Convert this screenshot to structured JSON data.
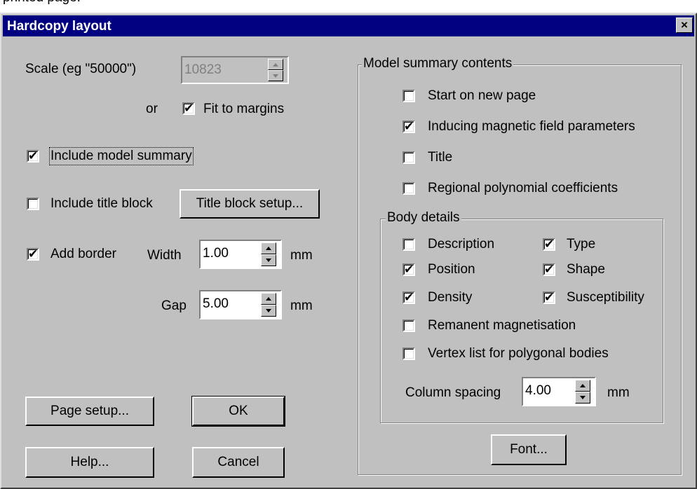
{
  "above_text": "printed page.",
  "window": {
    "title": "Hardcopy layout",
    "close": "×"
  },
  "scale": {
    "label": "Scale (eg \"50000\")",
    "value": "10823",
    "or_label": "or",
    "fit_to_margins": {
      "label": "Fit to margins",
      "checked": true
    }
  },
  "include_model_summary": {
    "label": "Include model summary",
    "checked": true
  },
  "include_title_block": {
    "label": "Include title block",
    "checked": false
  },
  "title_block_setup_button": "Title block setup...",
  "border": {
    "add_border": {
      "label": "Add border",
      "checked": true
    },
    "width_label": "Width",
    "width_value": "1.00",
    "width_unit": "mm",
    "gap_label": "Gap",
    "gap_value": "5.00",
    "gap_unit": "mm"
  },
  "buttons": {
    "page_setup": "Page setup...",
    "ok": "OK",
    "help": "Help...",
    "cancel": "Cancel",
    "font": "Font..."
  },
  "model_summary": {
    "group_label": "Model summary contents",
    "items": [
      {
        "label": "Start on new page",
        "checked": false
      },
      {
        "label": "Inducing magnetic field parameters",
        "checked": true
      },
      {
        "label": "Title",
        "checked": false
      },
      {
        "label": "Regional polynomial coefficients",
        "checked": false
      }
    ]
  },
  "body_details": {
    "group_label": "Body details",
    "description": {
      "label": "Description",
      "checked": false
    },
    "type": {
      "label": "Type",
      "checked": true
    },
    "position": {
      "label": "Position",
      "checked": true
    },
    "shape": {
      "label": "Shape",
      "checked": true
    },
    "density": {
      "label": "Density",
      "checked": true
    },
    "susceptibility": {
      "label": "Susceptibility",
      "checked": true
    },
    "remanent": {
      "label": "Remanent magnetisation",
      "checked": false
    },
    "vertex_list": {
      "label": "Vertex list for polygonal bodies",
      "checked": false
    },
    "column_spacing_label": "Column spacing",
    "column_spacing_value": "4.00",
    "column_spacing_unit": "mm"
  },
  "check_glyph": "✔"
}
